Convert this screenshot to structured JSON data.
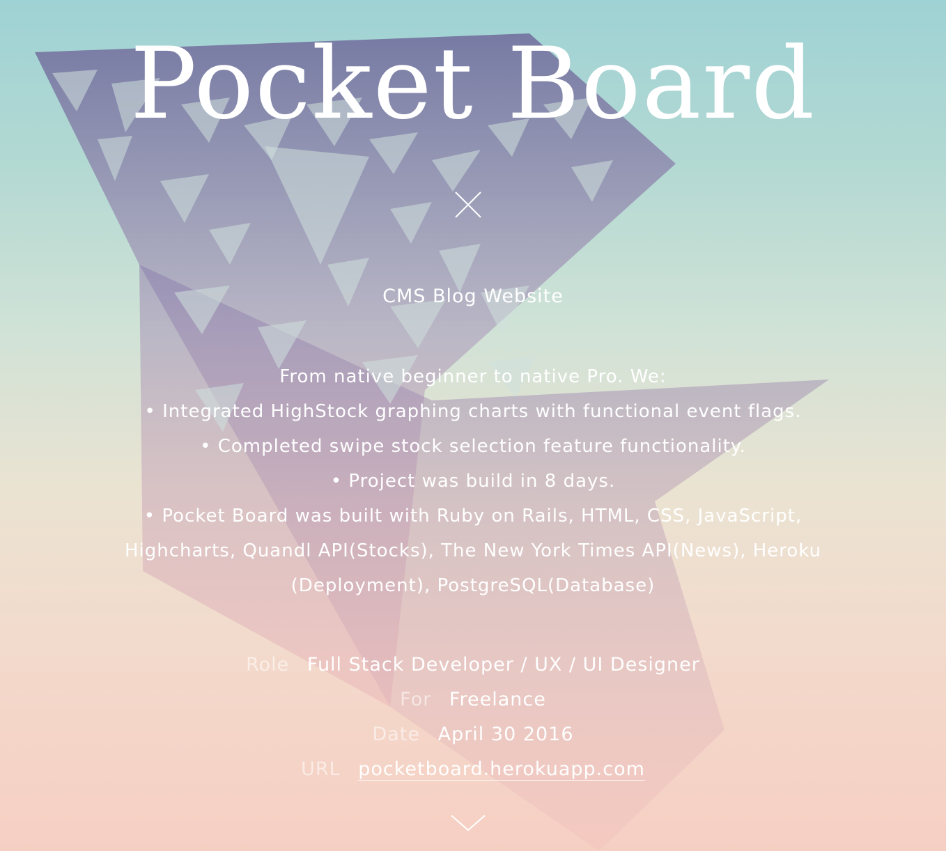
{
  "project": {
    "title": "Pocket Board",
    "subtitle": "CMS Blog Website",
    "description": [
      "From native beginner to native Pro. We:",
      "• Integrated HighStock graphing charts with functional event flags.",
      "• Completed swipe stock selection feature functionality.",
      "• Project was build in 8 days.",
      "• Pocket Board was built with Ruby on Rails, HTML, CSS, JavaScript, Highcharts, Quandl API(Stocks), The New York Times API(News), Heroku (Deployment), PostgreSQL(Database)"
    ],
    "meta": [
      {
        "label": "Role",
        "value": "Full Stack Developer / UX / UI Designer"
      },
      {
        "label": "For",
        "value": "Freelance"
      },
      {
        "label": "Date",
        "value": "April 30 2016"
      },
      {
        "label": "URL",
        "value": "pocketboard.herokuapp.com"
      }
    ]
  },
  "icons": {
    "close": "close-icon",
    "scroll_down": "chevron-down-icon"
  },
  "colors": {
    "text": "#ffffff",
    "label": "#ffffff8c",
    "gradient_top": "#9fd2d4",
    "gradient_bottom": "#f6cfc3",
    "art": "#7c6f9e"
  }
}
